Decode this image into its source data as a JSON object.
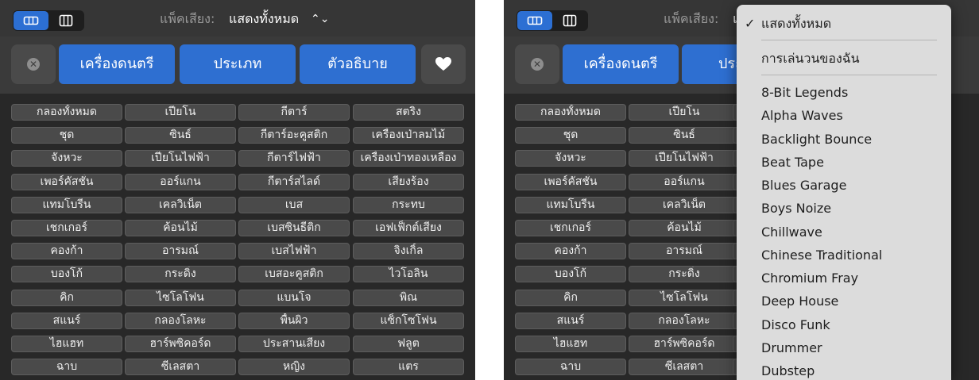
{
  "toolbar": {
    "pack_label": "แพ็คเสียง:",
    "pack_value": "แสดงทั้งหมด",
    "pack_value_partial": "แ",
    "updown_glyph": "⌃⌄"
  },
  "filters": {
    "instruments": "เครื่องดนตรี",
    "genre": "ประเภท",
    "descriptors": "ตัวอธิบาย",
    "genre_partial": "ประ",
    "clear_glyph": "✕"
  },
  "keywords": [
    [
      "กลองทั้งหมด",
      "เปียโน",
      "กีตาร์",
      "สตริง"
    ],
    [
      "ชุด",
      "ซินธ์",
      "กีตาร์อะคูสติก",
      "เครื่องเป่าลมไม้"
    ],
    [
      "จังหวะ",
      "เปียโนไฟฟ้า",
      "กีตาร์ไฟฟ้า",
      "เครื่องเป่าทองเหลือง"
    ],
    [
      "เพอร์คัสชั่น",
      "ออร์แกน",
      "กีตาร์สไลด์",
      "เสียงร้อง"
    ],
    [
      "แทมโบรีน",
      "เคลวิเน็ต",
      "เบส",
      "กระทบ"
    ],
    [
      "เชกเกอร์",
      "ค้อนไม้",
      "เบสซินธีติก",
      "เอฟเฟ็กต์เสียง"
    ],
    [
      "คองก้า",
      "อารมณ์",
      "เบสไฟฟ้า",
      "จิงเกิ้ล"
    ],
    [
      "บองโก้",
      "กระดิ่ง",
      "เบสอะคูสติก",
      "ไวโอลิน"
    ],
    [
      "คิก",
      "ไซโลโฟน",
      "แบนโจ",
      "พิณ"
    ],
    [
      "สแนร์",
      "กลองโลหะ",
      "พื้นผิว",
      "แซ็กโซโฟน"
    ],
    [
      "ไฮแฮท",
      "ฮาร์พซิคอร์ด",
      "ประสานเสียง",
      "ฟลูต"
    ],
    [
      "ฉาบ",
      "ซีเลสตา",
      "หญิง",
      "แตร"
    ]
  ],
  "dropdown": {
    "checkmark": "✓",
    "selected": "แสดงทั้งหมด",
    "my_loops": "การเล่นวนของฉัน",
    "packs": [
      "8-Bit Legends",
      "Alpha Waves",
      "Backlight Bounce",
      "Beat Tape",
      "Blues Garage",
      "Boys Noize",
      "Chillwave",
      "Chinese Traditional",
      "Chromium Fray",
      "Deep House",
      "Disco Funk",
      "Drummer",
      "Dubstep"
    ]
  }
}
